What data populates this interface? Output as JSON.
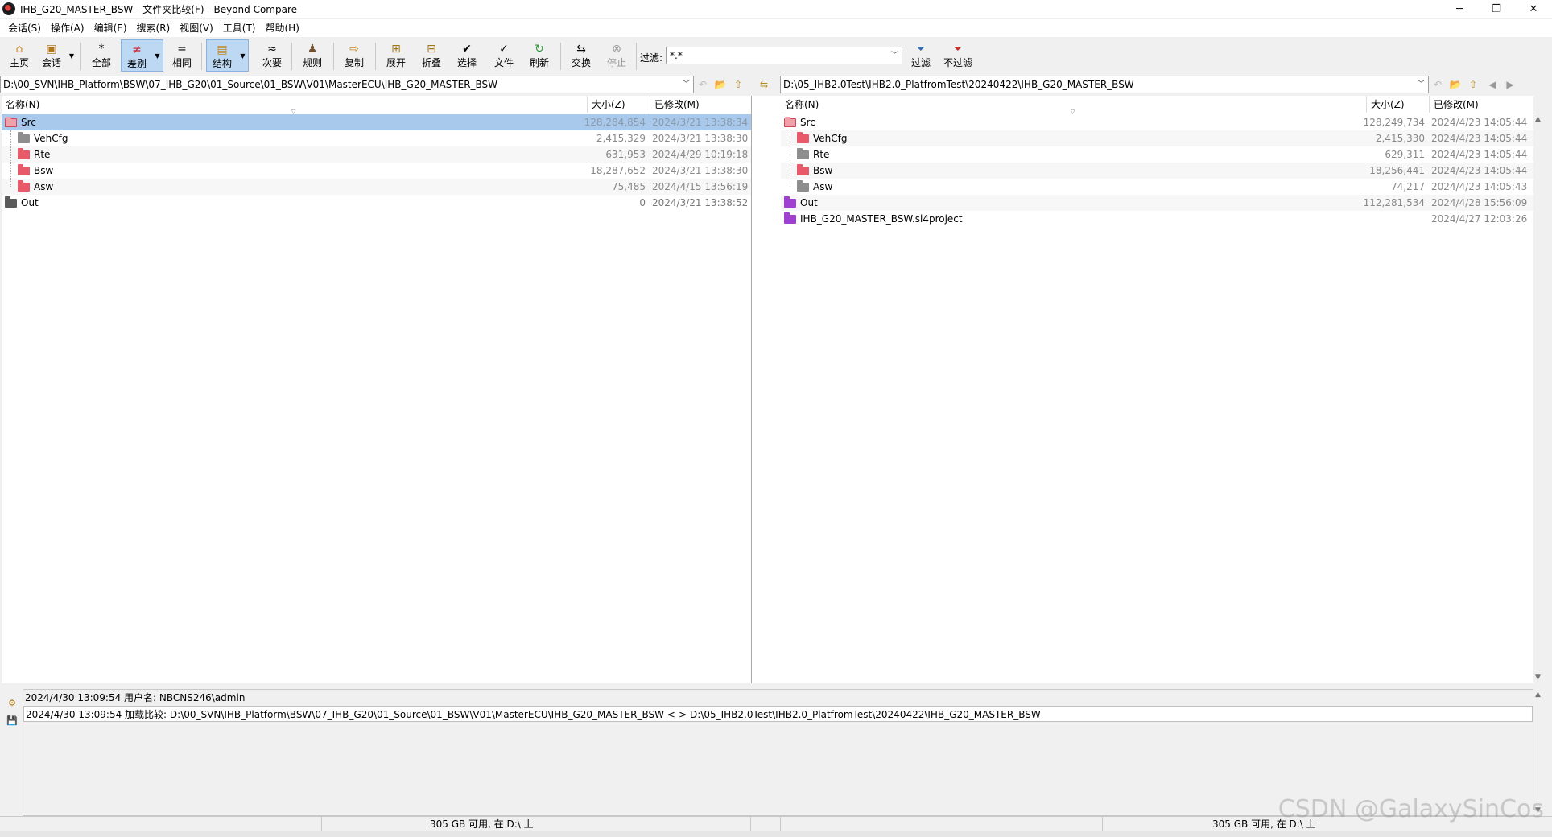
{
  "window": {
    "title": "IHB_G20_MASTER_BSW - 文件夹比较(F) - Beyond Compare",
    "minimize": "─",
    "maximize": "❐",
    "close": "✕"
  },
  "menu": [
    "会话(S)",
    "操作(A)",
    "编辑(E)",
    "搜索(R)",
    "视图(V)",
    "工具(T)",
    "帮助(H)"
  ],
  "toolbar": {
    "home": "主页",
    "session": "会话",
    "all": "全部",
    "diff": "差别",
    "same": "相同",
    "structure": "结构",
    "minor": "次要",
    "rules": "规则",
    "copy": "复制",
    "expand": "展开",
    "collapse": "折叠",
    "select": "选择",
    "files": "文件",
    "refresh": "刷新",
    "swap": "交换",
    "stop": "停止",
    "filter_label": "过滤:",
    "filter_value": "*.*",
    "filter_btn": "过滤",
    "no_filter_btn": "不过滤"
  },
  "left": {
    "path": "D:\\00_SVN\\IHB_Platform\\BSW\\07_IHB_G20\\01_Source\\01_BSW\\V01\\MasterECU\\IHB_G20_MASTER_BSW",
    "columns": {
      "name": "名称(N)",
      "size": "大小(Z)",
      "modified": "已修改(M)"
    },
    "rows": [
      {
        "name": "Src",
        "size": "128,284,854",
        "date": "2024/3/21 13:38:34"
      },
      {
        "name": "VehCfg",
        "size": "2,415,329",
        "date": "2024/3/21 13:38:30"
      },
      {
        "name": "Rte",
        "size": "631,953",
        "date": "2024/4/29 10:19:18"
      },
      {
        "name": "Bsw",
        "size": "18,287,652",
        "date": "2024/3/21 13:38:30"
      },
      {
        "name": "Asw",
        "size": "75,485",
        "date": "2024/4/15 13:56:19"
      },
      {
        "name": "Out",
        "size": "0",
        "date": "2024/3/21 13:38:52"
      }
    ]
  },
  "right": {
    "path": "D:\\05_IHB2.0Test\\IHB2.0_PlatfromTest\\20240422\\IHB_G20_MASTER_BSW",
    "columns": {
      "name": "名称(N)",
      "size": "大小(Z)",
      "modified": "已修改(M)"
    },
    "rows": [
      {
        "name": "Src",
        "size": "128,249,734",
        "date": "2024/4/23 14:05:44"
      },
      {
        "name": "VehCfg",
        "size": "2,415,330",
        "date": "2024/4/23 14:05:44"
      },
      {
        "name": "Rte",
        "size": "629,311",
        "date": "2024/4/23 14:05:44"
      },
      {
        "name": "Bsw",
        "size": "18,256,441",
        "date": "2024/4/23 14:05:44"
      },
      {
        "name": "Asw",
        "size": "74,217",
        "date": "2024/4/23 14:05:43"
      },
      {
        "name": "Out",
        "size": "112,281,534",
        "date": "2024/4/28 15:56:09"
      },
      {
        "name": "IHB_G20_MASTER_BSW.si4project",
        "size": "",
        "date": "2024/4/27 12:03:26"
      }
    ]
  },
  "log": [
    "2024/4/30 13:09:54  用户名: NBCNS246\\admin",
    "2024/4/30 13:09:54  加载比较: D:\\00_SVN\\IHB_Platform\\BSW\\07_IHB_G20\\01_Source\\01_BSW\\V01\\MasterECU\\IHB_G20_MASTER_BSW <-> D:\\05_IHB2.0Test\\IHB2.0_PlatfromTest\\20240422\\IHB_G20_MASTER_BSW"
  ],
  "status": {
    "left_free": "305 GB 可用, 在 D:\\ 上",
    "right_free": "305 GB 可用, 在 D:\\ 上"
  },
  "watermark": "CSDN @GalaxySinCos",
  "colors": {
    "selection": "#a8c8ec",
    "folder_diff": "#e85a6a",
    "folder_same": "#8e8e8e",
    "folder_orphan": "#a040d0"
  }
}
